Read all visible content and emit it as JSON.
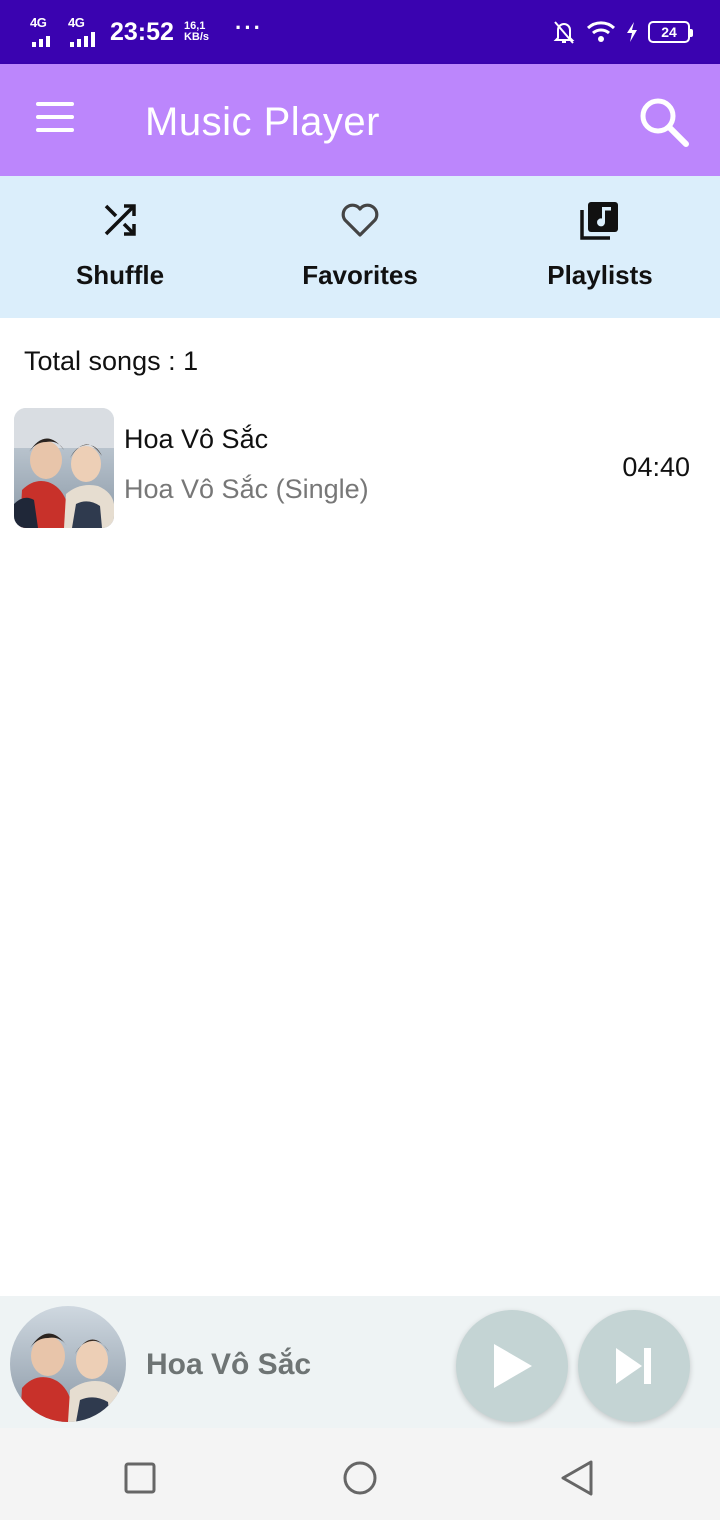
{
  "status_bar": {
    "network1": "4G",
    "network2": "4G",
    "time": "23:52",
    "speed_value": "16,1",
    "speed_unit": "KB/s",
    "more": "···",
    "battery": "24"
  },
  "app_bar": {
    "title": "Music Player"
  },
  "tabs": [
    {
      "label": "Shuffle",
      "icon": "shuffle-icon"
    },
    {
      "label": "Favorites",
      "icon": "heart-icon"
    },
    {
      "label": "Playlists",
      "icon": "playlist-icon"
    }
  ],
  "library": {
    "total_label": "Total songs : 1"
  },
  "songs": [
    {
      "title": "Hoa Vô Sắc",
      "album": "Hoa Vô Sắc (Single)",
      "duration": "04:40"
    }
  ],
  "mini_player": {
    "title": "Hoa Vô Sắc"
  },
  "colors": {
    "status_bar": "#3a03b0",
    "app_bar": "#bc86fc",
    "tab_row": "#dbeefb",
    "mini_player": "#eef3f4",
    "control_button": "#c4d4d4"
  }
}
